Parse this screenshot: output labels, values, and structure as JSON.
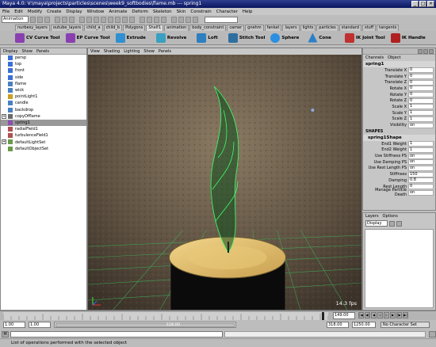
{
  "window": {
    "title": "Maya 4.0: V:\\maya\\projects\\particles\\scenes\\week9_softbodies\\flame.mb   ---   spring1"
  },
  "menubar": [
    "File",
    "Edit",
    "Modify",
    "Create",
    "Display",
    "Window",
    "Animate",
    "Deform",
    "Skeleton",
    "Skin",
    "Constrain",
    "Character",
    "Help"
  ],
  "status_line": {
    "mode": "Animation"
  },
  "shelf_tabs": [
    "nurbesy_layers",
    "outube_layers",
    "child_a",
    "child_b",
    "Polygons",
    "Shelf1",
    "animation",
    "body_constraint",
    "camer",
    "gnehm",
    "fankat",
    "layers",
    "lights",
    "particles",
    "standard",
    "stuff",
    "tangents"
  ],
  "shelf_tools": [
    {
      "label": "CV Curve Tool",
      "color": "#8a3fb0"
    },
    {
      "label": "EP Curve Tool",
      "color": "#8a3fb0"
    },
    {
      "label": "Extrude",
      "color": "#2f8fd0"
    },
    {
      "label": "Revolve",
      "color": "#3aa0c0"
    },
    {
      "label": "Loft",
      "color": "#2d7fc0"
    },
    {
      "label": "Stitch Tool",
      "color": "#2f6fa0"
    },
    {
      "label": "Sphere",
      "color": "#2a8fe0"
    },
    {
      "label": "Cone",
      "color": "#2a80c8"
    },
    {
      "label": "IK Joint Tool",
      "color": "#c03030"
    },
    {
      "label": "IK Handle",
      "color": "#b02020"
    }
  ],
  "outliner": {
    "menu": [
      "Display",
      "Show",
      "Panels"
    ],
    "items": [
      {
        "label": "persp",
        "icon": "camera-icon",
        "expand": false,
        "selected": false
      },
      {
        "label": "top",
        "icon": "camera-icon",
        "expand": false,
        "selected": false
      },
      {
        "label": "front",
        "icon": "camera-icon",
        "expand": false,
        "selected": false
      },
      {
        "label": "side",
        "icon": "camera-icon",
        "expand": false,
        "selected": false
      },
      {
        "label": "flame",
        "icon": "nurbs-icon",
        "expand": false,
        "selected": false
      },
      {
        "label": "wick",
        "icon": "nurbs-icon",
        "expand": false,
        "selected": false
      },
      {
        "label": "pointLight1",
        "icon": "light-icon",
        "expand": false,
        "selected": false
      },
      {
        "label": "candle",
        "icon": "nurbs-icon",
        "expand": false,
        "selected": false
      },
      {
        "label": "backdrop",
        "icon": "nurbs-icon",
        "expand": false,
        "selected": false
      },
      {
        "label": "copyOfflame",
        "icon": "group-icon",
        "expand": true,
        "selected": false
      },
      {
        "label": "spring1",
        "icon": "spring-icon",
        "expand": false,
        "selected": true
      },
      {
        "label": "radialField1",
        "icon": "field-icon",
        "expand": false,
        "selected": false
      },
      {
        "label": "turbulenceField1",
        "icon": "field-icon",
        "expand": false,
        "selected": false
      },
      {
        "label": "defaultLightSet",
        "icon": "set-icon",
        "expand": true,
        "selected": false
      },
      {
        "label": "defaultObjectSet",
        "icon": "set-icon",
        "expand": false,
        "selected": false
      }
    ]
  },
  "viewport": {
    "menu": [
      "View",
      "Shading",
      "Lighting",
      "Show",
      "Panels"
    ],
    "fps": "14.3 fps"
  },
  "channel_box": {
    "menu": [
      "Channels",
      "Object"
    ],
    "object_name": "spring1",
    "transform": [
      {
        "label": "Translate X",
        "value": "0"
      },
      {
        "label": "Translate Y",
        "value": "0"
      },
      {
        "label": "Translate Z",
        "value": "0"
      },
      {
        "label": "Rotate X",
        "value": "0"
      },
      {
        "label": "Rotate Y",
        "value": "0"
      },
      {
        "label": "Rotate Z",
        "value": "0"
      },
      {
        "label": "Scale X",
        "value": "1"
      },
      {
        "label": "Scale Y",
        "value": "1"
      },
      {
        "label": "Scale Z",
        "value": "1"
      },
      {
        "label": "Visibility",
        "value": "on"
      }
    ],
    "shapes_label": "SHAPES",
    "shape_name": "spring1Shape",
    "shape_attrs": [
      {
        "label": "End1 Weight",
        "value": "1"
      },
      {
        "label": "End2 Weight",
        "value": "1"
      },
      {
        "label": "Use Stiffness PS",
        "value": "on"
      },
      {
        "label": "Use Damping PS",
        "value": "on"
      },
      {
        "label": "Use Rest Length PS",
        "value": "on"
      },
      {
        "label": "Stiffness",
        "value": "150"
      },
      {
        "label": "Damping",
        "value": "0.8"
      },
      {
        "label": "Rest Length",
        "value": "0"
      },
      {
        "label": "Manage Particle Death",
        "value": "on"
      }
    ]
  },
  "layers": {
    "menu": [
      "Layers",
      "Options"
    ],
    "selected": "Display"
  },
  "time_slider": {
    "current_time": "149.00"
  },
  "range_slider": {
    "anim_start": "1.00",
    "range_start": "1.00",
    "range_end_inner": "318.00",
    "range_end": "318.00",
    "anim_end": "1250.00",
    "character_set": "No Character Set"
  },
  "help_line": {
    "text": "List of operations performed with the selected object"
  }
}
